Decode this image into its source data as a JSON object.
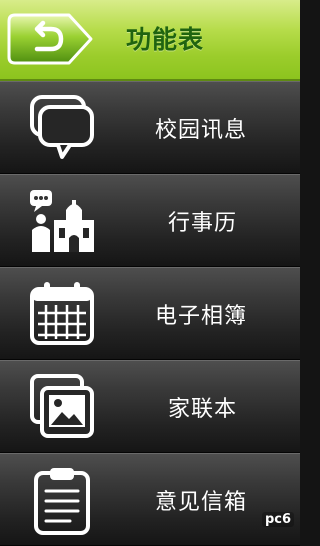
{
  "header": {
    "title": "功能表",
    "back_icon": "back-arrow-icon",
    "accent_color": "#9ccd2c",
    "title_color": "#1f6410"
  },
  "menu": {
    "items": [
      {
        "label": "校园讯息",
        "icon": "chat-bubbles-icon"
      },
      {
        "label": "行事历",
        "icon": "school-building-icon"
      },
      {
        "label": "电子相簿",
        "icon": "calendar-icon"
      },
      {
        "label": "家联本",
        "icon": "photo-album-icon"
      },
      {
        "label": "意见信箱",
        "icon": "clipboard-icon"
      }
    ]
  },
  "watermark": {
    "text": "pc6"
  }
}
